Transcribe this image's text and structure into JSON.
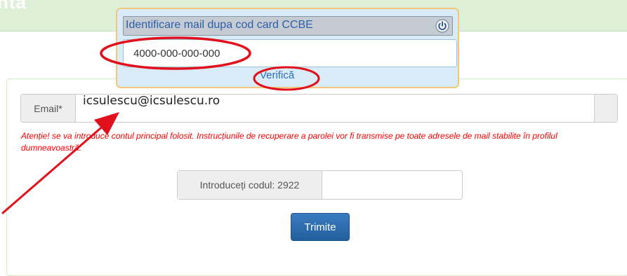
{
  "header": {
    "title": "ntă"
  },
  "lookup_popup": {
    "title": "Identificare mail dupa cod card CCBE",
    "card_code_value": "4000-000-000-000",
    "verify_label": "Verifică",
    "icon": "power-icon"
  },
  "form": {
    "email_label": "Email*",
    "email_value": "icsulescu@icsulescu.ro",
    "warning": "Atenție! se va introduce contul principal folosit. Instrucțiunile de recuperare a parolei vor fi transmise pe toate adresele de mail stabilite în profilul dumneavoastră.",
    "captcha_label": "Introduceți codul: 2922",
    "captcha_value": "",
    "submit_label": "Trimite"
  },
  "annotations": {
    "highlight_color": "#e0101c",
    "marks": [
      "ellipse-card-code",
      "ellipse-verify-link",
      "arrow-to-email-field"
    ]
  }
}
